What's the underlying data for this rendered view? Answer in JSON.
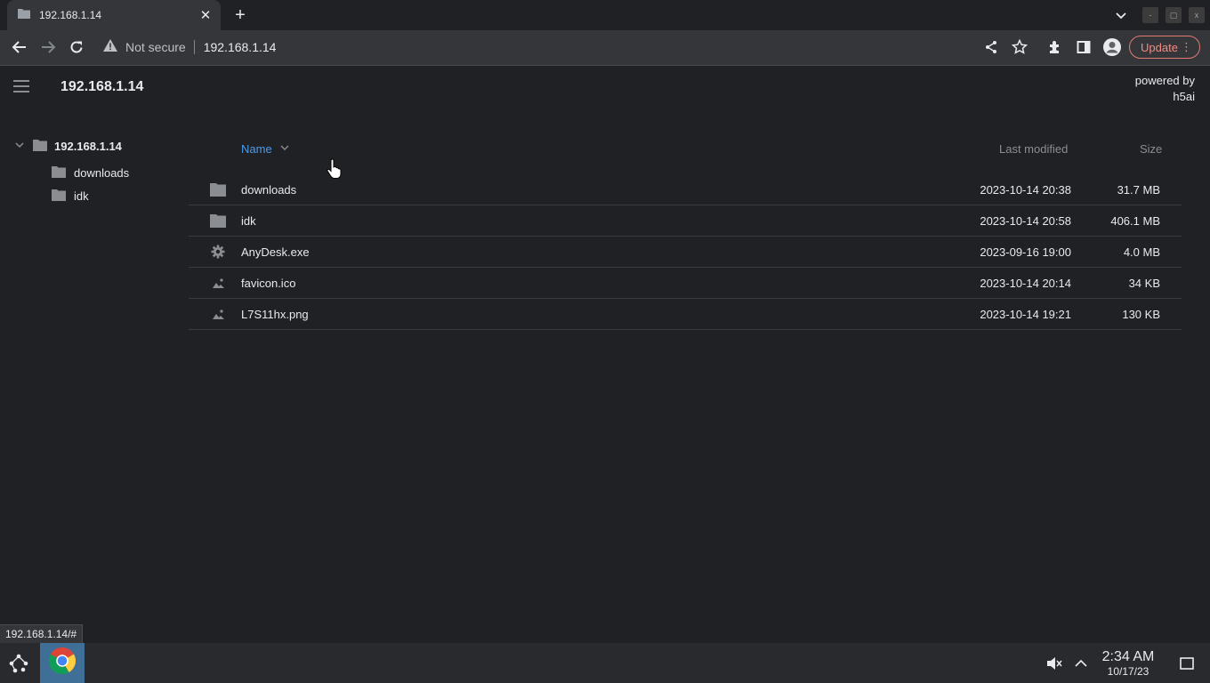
{
  "browser": {
    "tab_title": "192.168.1.14",
    "security_label": "Not secure",
    "url": "192.168.1.14",
    "update_label": "Update",
    "status_url": "192.168.1.14/#",
    "window_controls": [
      "-",
      "▢",
      "x"
    ]
  },
  "page": {
    "site_title": "192.168.1.14",
    "powered_by": "powered by h5ai"
  },
  "tree": {
    "root": "192.168.1.14",
    "children": [
      "downloads",
      "idk"
    ]
  },
  "list": {
    "headers": {
      "name": "Name",
      "modified": "Last modified",
      "size": "Size"
    },
    "rows": [
      {
        "icon": "folder-icon",
        "name": "downloads",
        "modified": "2023-10-14 20:38",
        "size": "31.7 MB"
      },
      {
        "icon": "folder-icon",
        "name": "idk",
        "modified": "2023-10-14 20:58",
        "size": "406.1 MB"
      },
      {
        "icon": "gear-icon",
        "name": "AnyDesk.exe",
        "modified": "2023-09-16 19:00",
        "size": "4.0 MB"
      },
      {
        "icon": "image-icon",
        "name": "favicon.ico",
        "modified": "2023-10-14 20:14",
        "size": "34 KB"
      },
      {
        "icon": "image-icon",
        "name": "L7S11hx.png",
        "modified": "2023-10-14 19:21",
        "size": "130 KB"
      }
    ]
  },
  "taskbar": {
    "time": "2:34 AM",
    "date": "10/17/23"
  },
  "colors": {
    "background": "#202124",
    "toolbar": "#35363a",
    "accent_link": "#4c9be8",
    "update": "#f28b82"
  }
}
